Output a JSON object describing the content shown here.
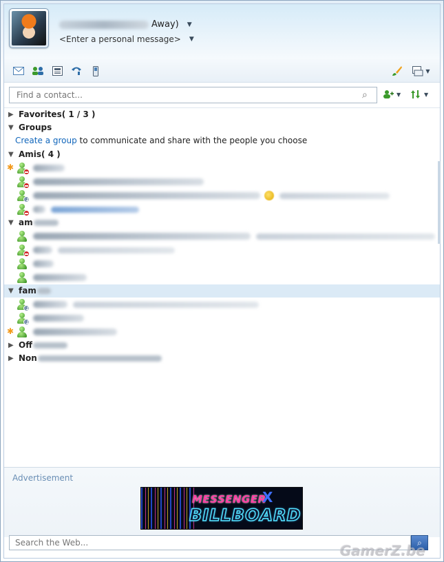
{
  "header": {
    "status_text": "Away)",
    "personal_message": "<Enter a personal message>"
  },
  "toolbar": {
    "icons": [
      "mail-icon",
      "contacts-icon",
      "news-icon",
      "phone-icon",
      "mobile-icon",
      "customize-icon",
      "menu-icon"
    ]
  },
  "contacts_search": {
    "placeholder": "Find a contact..."
  },
  "list": {
    "favorites": {
      "label": "Favorites",
      "count": "( 1 / 3 )"
    },
    "groups": {
      "label": "Groups",
      "create_link": "Create a group",
      "create_rest": " to communicate and share with the people you choose"
    },
    "amis": {
      "label": "Amis",
      "count": "( 4 )"
    },
    "group2": {
      "label_prefix": "am"
    },
    "group3": {
      "label_prefix": "fam"
    },
    "group4": {
      "label_prefix": "Off"
    },
    "group5": {
      "label_prefix": "Non"
    }
  },
  "ad": {
    "label": "Advertisement",
    "banner_line1": "MESSENGER",
    "banner_x": "X",
    "banner_line2": "BILLBOARD"
  },
  "web_search": {
    "placeholder": "Search the Web..."
  },
  "watermark": "GamerZ.be"
}
